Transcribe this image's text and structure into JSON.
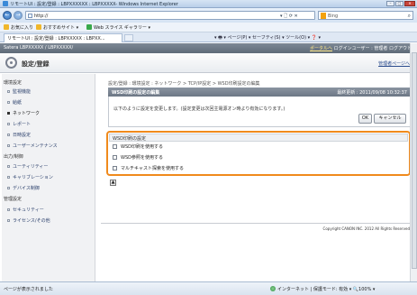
{
  "browser": {
    "title": "リモートUI : 設定/登録 : LBPXXXXXX : LBPXXXXX- Windows Internet Explorer",
    "url": "http://",
    "search_placeholder": "Bing",
    "favorites": [
      "お気に入り",
      "おすすめサイト ▾",
      "Web スライス ギャラリー ▾"
    ],
    "tab_title": "リモートUI : 設定/登録 : LBPXXXXX : LBPXX...",
    "command_bar": "▾ 🖶 ▾ ページ(P) ▾  セーフティ(S) ▾  ツール(O) ▾  ❓ ▾"
  },
  "header": {
    "device": "Satera    LBPXXXXX / LBPXXXXX/",
    "portal_link": "ポータルへ",
    "logout": "ログインユーザー : 管理者  ログアウト",
    "page_title": "設定/登録",
    "portal_return": "管理者ページへ"
  },
  "sidebar": {
    "env_heading": "環境設定",
    "env_items": [
      {
        "label": "監視機能",
        "active": false
      },
      {
        "label": "給紙",
        "active": false
      },
      {
        "label": "ネットワーク",
        "active": true
      },
      {
        "label": "レポート",
        "active": false
      },
      {
        "label": "日時設定",
        "active": false
      },
      {
        "label": "ユーザーメンテナンス",
        "active": false
      }
    ],
    "io_heading": "出力/制御",
    "io_items": [
      {
        "label": "ユーティリティー",
        "active": false
      },
      {
        "label": "キャリブレーション",
        "active": false
      },
      {
        "label": "デバイス制御",
        "active": false
      }
    ],
    "mgmt_heading": "管理設定",
    "mgmt_items": [
      {
        "label": "セキュリティー",
        "active": false
      },
      {
        "label": "ライセンス/その他",
        "active": false
      }
    ]
  },
  "main": {
    "breadcrumb": "設定/登録 : 環境設定 : ネットワーク > TCP/IP設定 > WSD印刷設定の編集",
    "panel_title": "WSD印刷の設定の編集",
    "last_updated": "最終更新 : 2011/09/08 10:32:37",
    "description": "以下のように設定を変更します。(設定変更は次回主電源オン時より有効になります。)",
    "ok_label": "OK",
    "cancel_label": "キャンセル",
    "settings_heading": "WSD印刷の設定",
    "options": [
      {
        "label": "WSD印刷を使用する",
        "checked": false
      },
      {
        "label": "WSD参照を使用する",
        "checked": false
      },
      {
        "label": "マルチキャスト探索を使用する",
        "checked": false
      }
    ],
    "copyright": "Copyright CANON INC. 2012 All Rights Reserved"
  },
  "status": {
    "left": "ページが表示されました",
    "right": "インターネット | 保護モード: 有効          ▾  🔍100%  ▾"
  }
}
